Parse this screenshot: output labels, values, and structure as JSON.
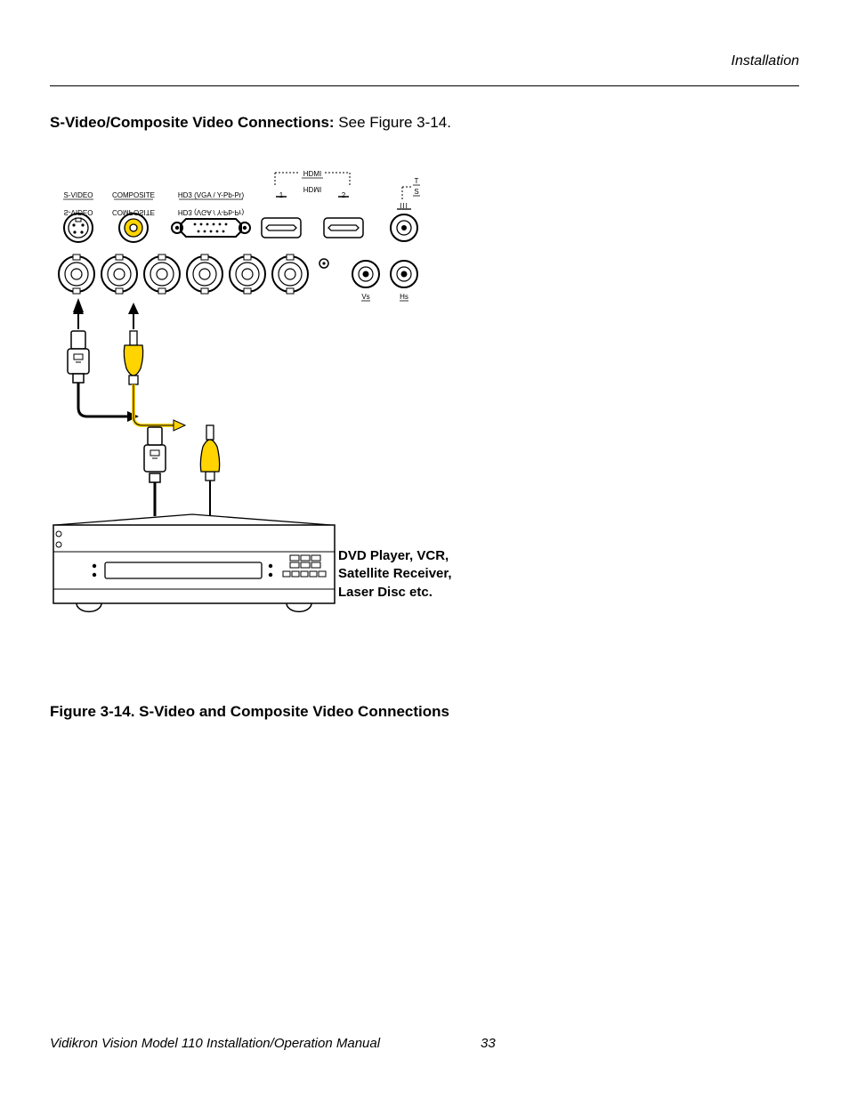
{
  "header": {
    "section": "Installation"
  },
  "heading": {
    "bold": "S-Video/Composite Video Connections: ",
    "rest": "See Figure 3-14."
  },
  "panel": {
    "svideo": "S-VIDEO",
    "composite": "COMPOSITE",
    "hd3": "HD3 (VGA / Y-Pb-Pr)",
    "hdmi": "HDMI",
    "hdmi1": "1",
    "hdmi2": "2",
    "t": "T",
    "s": "S",
    "iii": "III",
    "vs": "Vs",
    "hs": "Hs"
  },
  "device_label": {
    "l1": "DVD Player, VCR,",
    "l2": "Satellite Receiver,",
    "l3": "Laser Disc etc."
  },
  "figure_caption": "Figure 3-14. S-Video and Composite Video Connections",
  "footer": {
    "manual": "Vidikron Vision Model 110 Installation/Operation Manual",
    "page": "33"
  }
}
